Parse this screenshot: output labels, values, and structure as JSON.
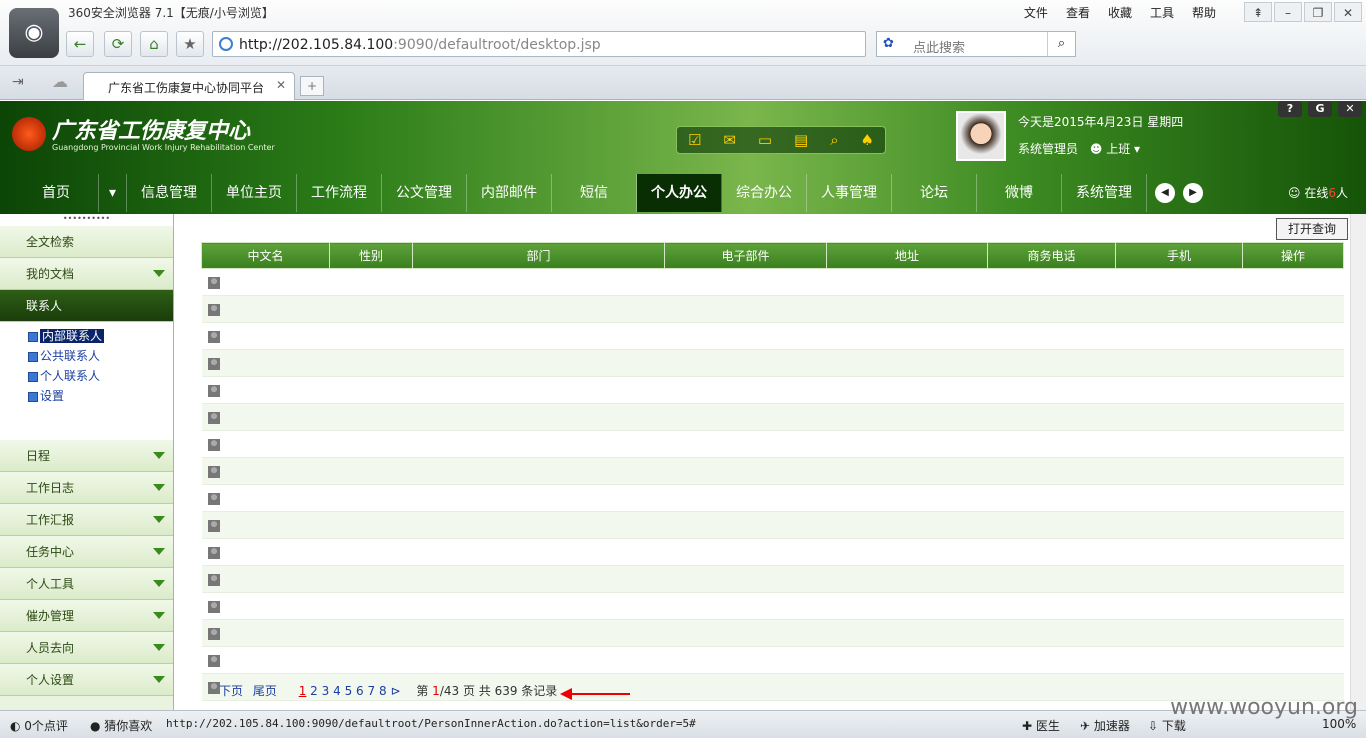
{
  "browser": {
    "title": "360安全浏览器 7.1【无痕/小号浏览】",
    "menu": [
      "文件",
      "查看",
      "收藏",
      "工具",
      "帮助"
    ],
    "url_host": "http://202.105.84.100",
    "url_rest": ":9090/defaultroot/desktop.jsp",
    "search_placeholder": "点此搜索",
    "tab_title": "广东省工伤康复中心协同平台"
  },
  "site": {
    "brand": "广东省工伤康复中心",
    "brand_en": "Guangdong Provincial Work Injury Rehabilitation Center",
    "date": "今天是2015年4月23日 星期四",
    "user": "系统管理员",
    "status": "上班",
    "online_prefix": "在线",
    "online_suffix": "人",
    "nav": [
      "首页",
      "▾",
      "信息管理",
      "单位主页",
      "工作流程",
      "公文管理",
      "内部邮件",
      "短信",
      "个人办公",
      "综合办公",
      "人事管理",
      "论坛",
      "微博",
      "系统管理"
    ]
  },
  "sidebar": {
    "sections_top": [
      "全文检索",
      "我的文档"
    ],
    "open_section": "联系人",
    "tree": [
      "内部联系人",
      "公共联系人",
      "个人联系人",
      "设置"
    ],
    "sections_bottom": [
      "日程",
      "工作日志",
      "工作汇报",
      "任务中心",
      "个人工具",
      "催办管理",
      "人员去向",
      "个人设置"
    ]
  },
  "content": {
    "open_query": "打开查询",
    "columns": [
      "中文名",
      "性别",
      "部门",
      "电子部件",
      "地址",
      "商务电话",
      "手机",
      "操作"
    ],
    "pager": {
      "next": "下页",
      "last": "尾页",
      "current_page": "1",
      "pages": [
        "2",
        "3",
        "4",
        "5",
        "6",
        "7",
        "8"
      ],
      "page_prefix": "第",
      "page_of": "/43 页 共 639 条记录"
    }
  },
  "statusbar": {
    "comments": "0个点评",
    "guess": "猜你喜欢",
    "link": "http://202.105.84.100:9090/defaultroot/PersonInnerAction.do?action=list&order=5#",
    "doctor": "医生",
    "accelerator": "加速器",
    "download": "下载",
    "zoom": "100%"
  },
  "watermark": "www.wooyun.org"
}
